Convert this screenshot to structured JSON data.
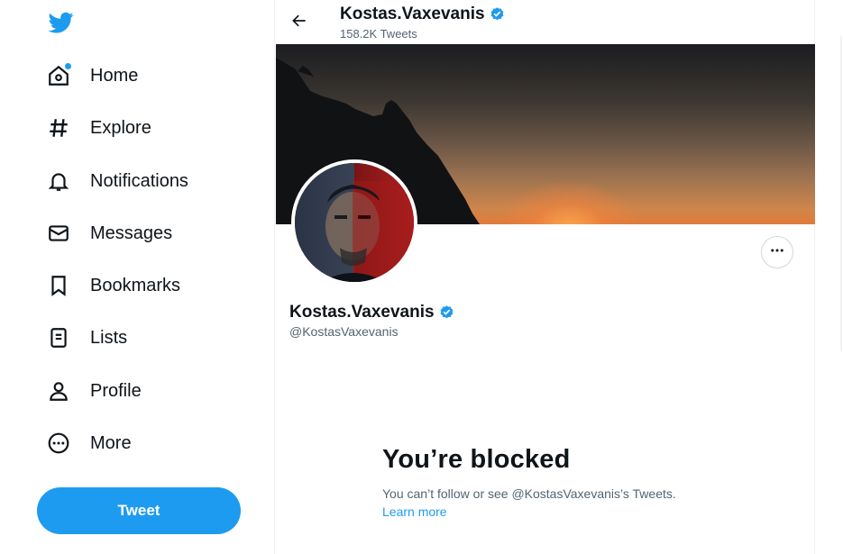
{
  "nav": {
    "items": [
      {
        "label": "Home",
        "icon": "home-icon"
      },
      {
        "label": "Explore",
        "icon": "hashtag-icon"
      },
      {
        "label": "Notifications",
        "icon": "bell-icon"
      },
      {
        "label": "Messages",
        "icon": "envelope-icon"
      },
      {
        "label": "Bookmarks",
        "icon": "bookmark-icon"
      },
      {
        "label": "Lists",
        "icon": "list-icon"
      },
      {
        "label": "Profile",
        "icon": "person-icon"
      },
      {
        "label": "More",
        "icon": "more-circle-icon"
      }
    ],
    "tweet_label": "Tweet"
  },
  "header": {
    "name": "Kostas.Vaxevanis",
    "tweet_count": "158.2K Tweets"
  },
  "profile": {
    "name": "Kostas.Vaxevanis",
    "handle": "@KostasVaxevanis",
    "verified": true
  },
  "blocked": {
    "title": "You’re blocked",
    "message": "You can’t follow or see @KostasVaxevanis’s Tweets.",
    "link": "Learn more"
  },
  "colors": {
    "accent": "#1d9bf0",
    "text": "#0f1419",
    "secondary": "#536471"
  }
}
